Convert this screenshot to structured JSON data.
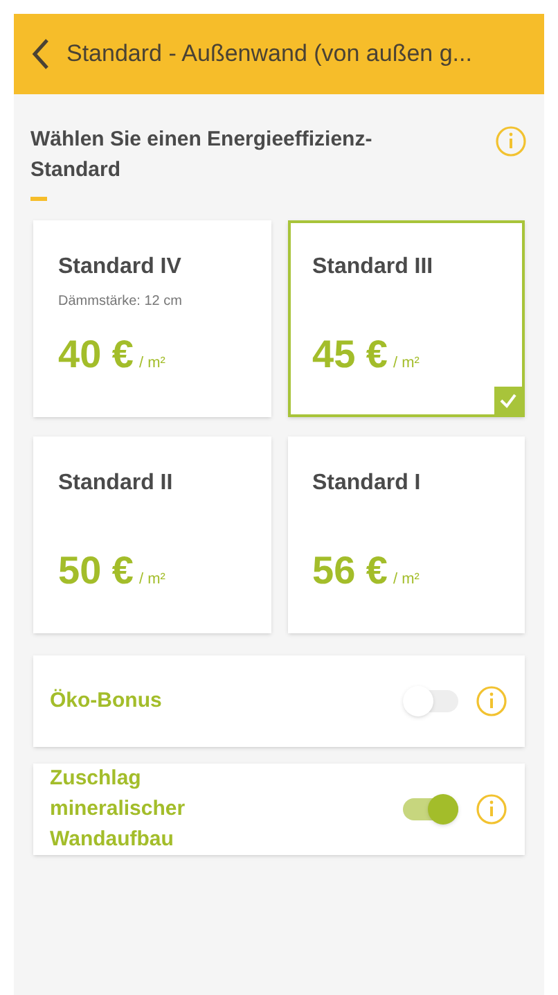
{
  "header": {
    "title": "Standard - Außenwand (von außen g..."
  },
  "section": {
    "title": "Wählen Sie einen Energieeffizienz-Standard"
  },
  "standards": [
    {
      "name": "Standard IV",
      "note": "Dämmstärke: 12 cm",
      "price": "40 €",
      "unit": "/ m²",
      "selected": false
    },
    {
      "name": "Standard III",
      "price": "45 €",
      "unit": "/ m²",
      "selected": true
    },
    {
      "name": "Standard II",
      "price": "50 €",
      "unit": "/ m²",
      "selected": false
    },
    {
      "name": "Standard I",
      "price": "56 €",
      "unit": "/ m²",
      "selected": false
    }
  ],
  "options": [
    {
      "label": "Öko-Bonus",
      "on": false
    },
    {
      "label": "Zuschlag mineralischer Wandaufbau",
      "on": true
    }
  ]
}
